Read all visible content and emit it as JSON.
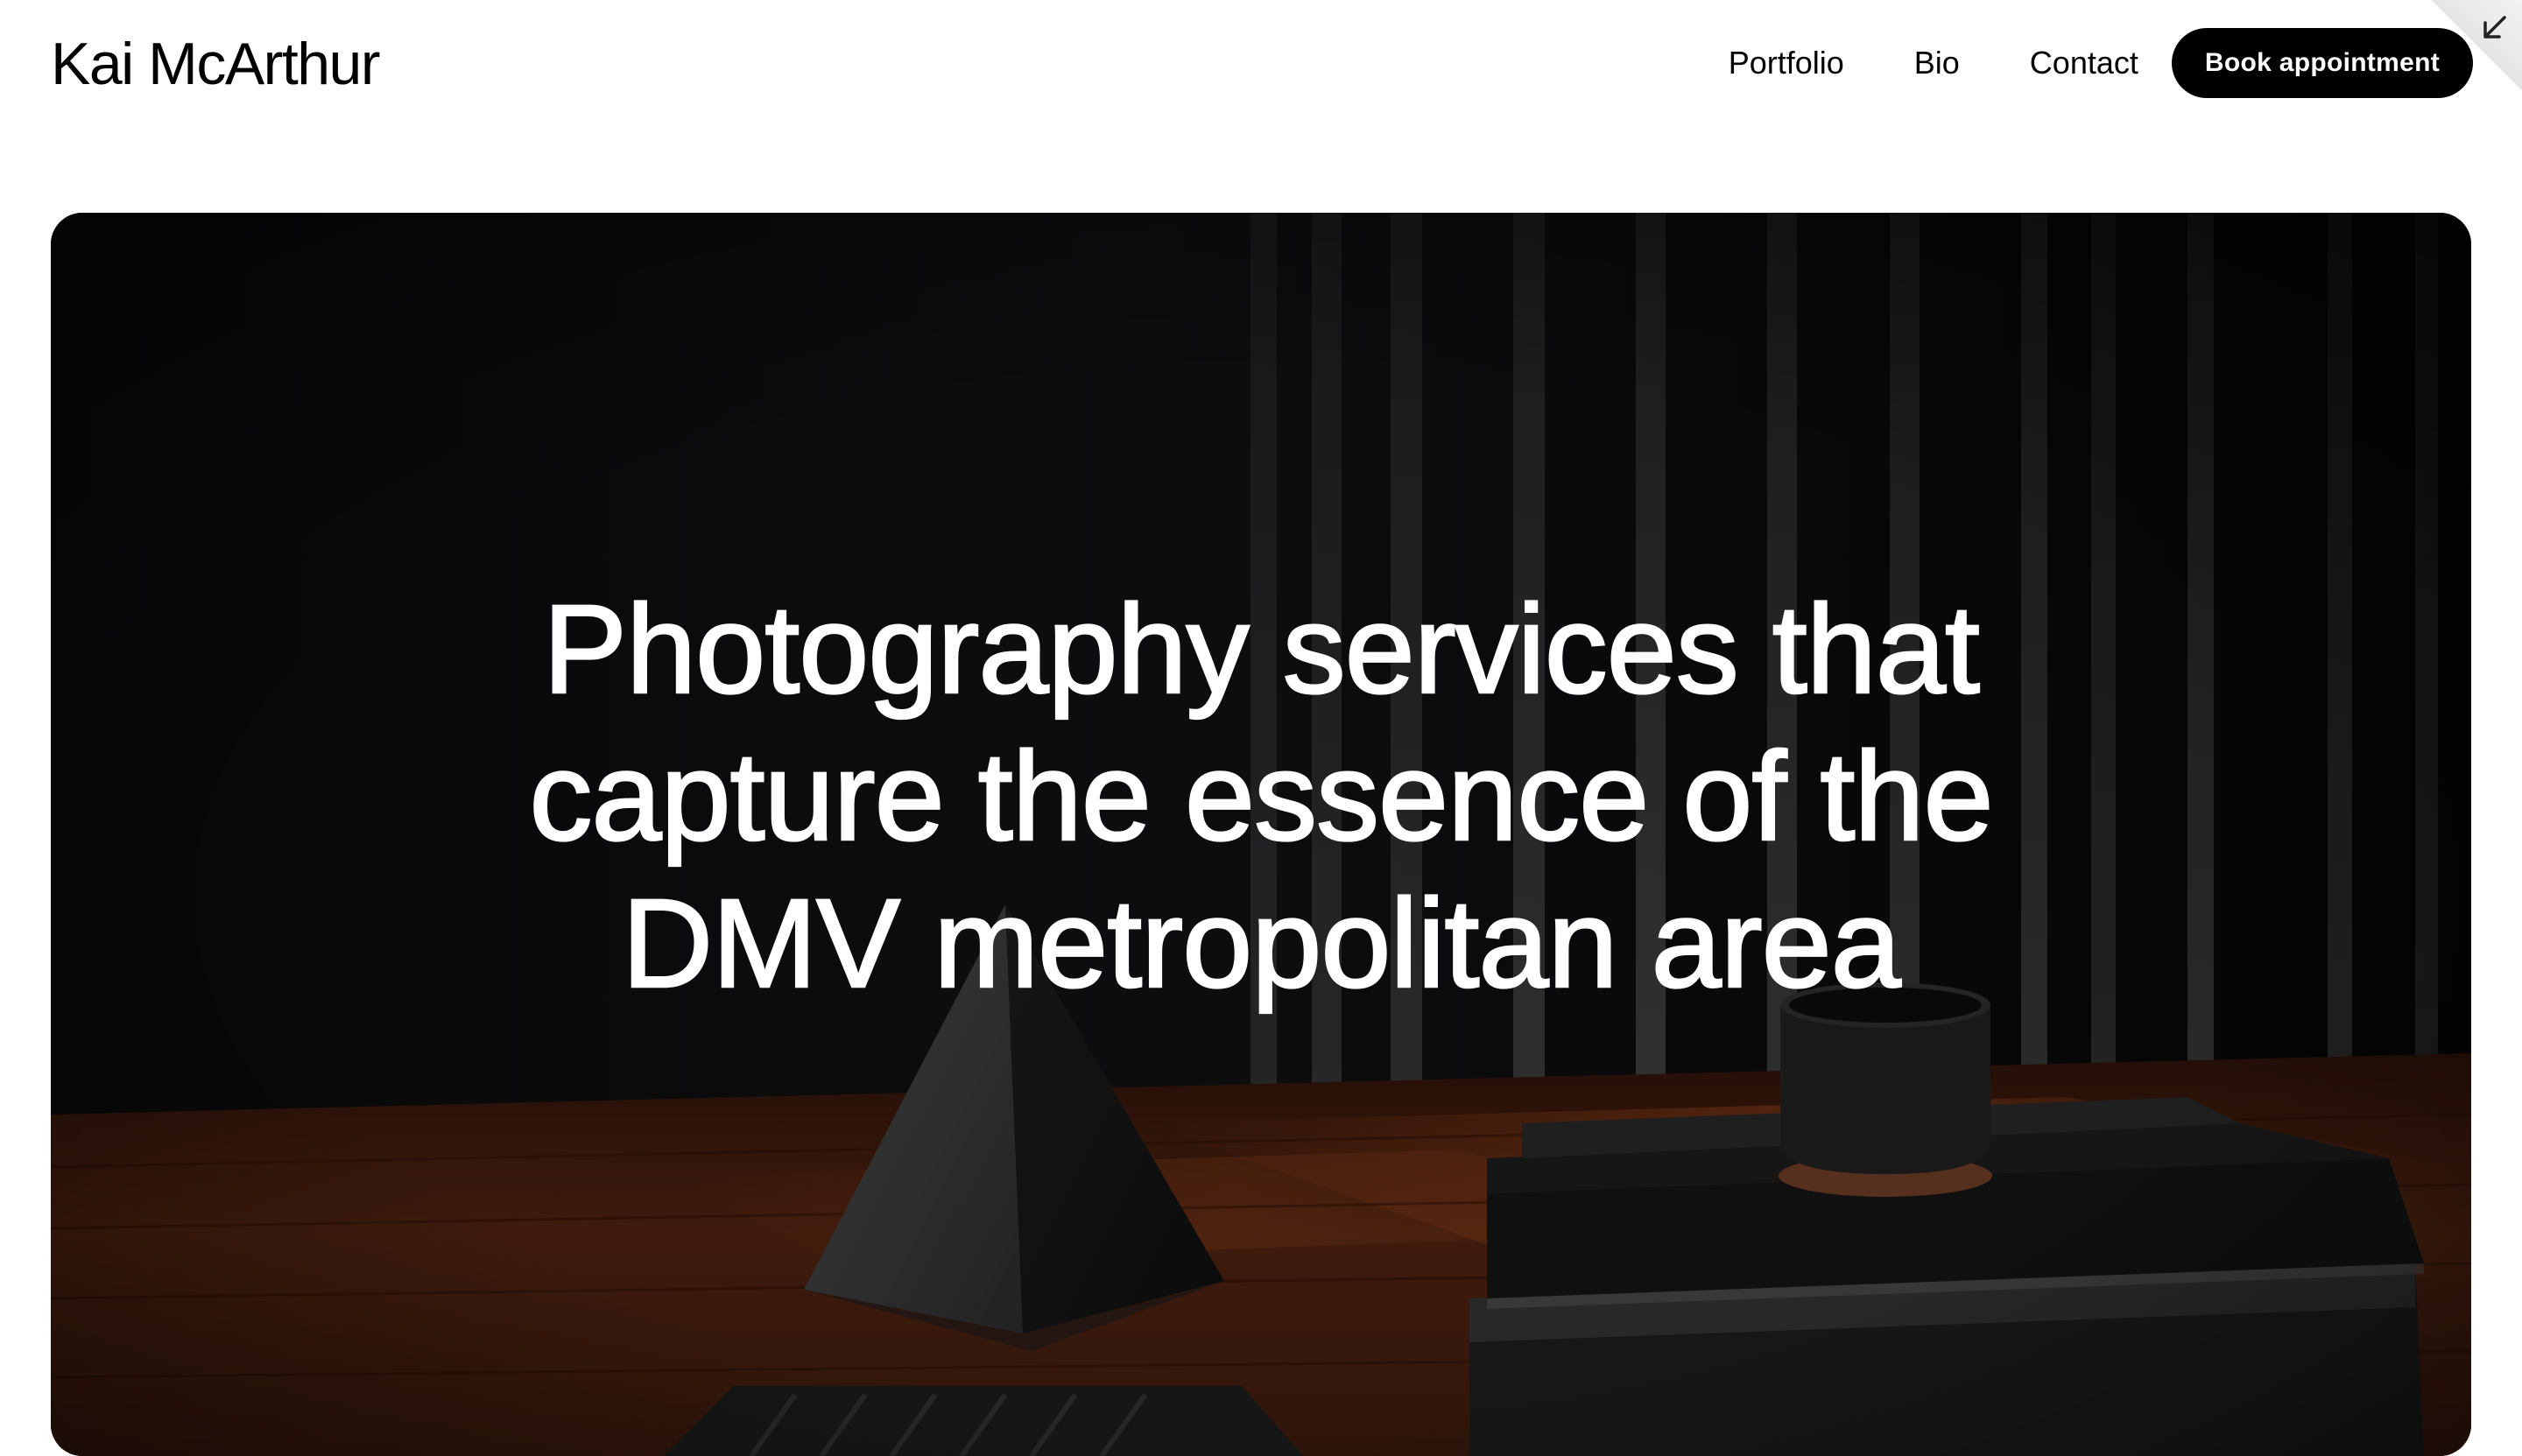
{
  "brand": {
    "name": "Kai McArthur"
  },
  "nav": {
    "items": [
      {
        "label": "Portfolio"
      },
      {
        "label": "Bio"
      },
      {
        "label": "Contact"
      }
    ],
    "cta_label": "Book appointment"
  },
  "hero": {
    "heading_lines": [
      "Photography services that",
      "capture the essence of the",
      "DMV metropolitan area"
    ]
  },
  "icons": {
    "corner": "arrow-down-left-icon"
  },
  "colors": {
    "background": "#ffffff",
    "text": "#000000",
    "button_bg": "#000000",
    "button_text": "#ffffff",
    "hero_text": "#ffffff",
    "wood": "#5a2a16"
  }
}
